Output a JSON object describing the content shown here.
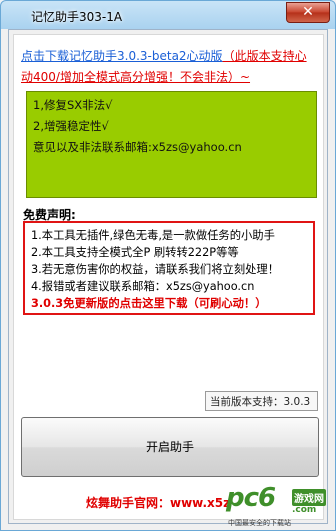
{
  "window": {
    "title": "记忆助手303-1A",
    "close_label": "✕",
    "app_icon": "apple-icon",
    "colors": {
      "frame": "#a9d2ef",
      "close": "#c7432c"
    }
  },
  "download_link": {
    "part1": "点击下载记忆助手3.0.3-beta2心动版",
    "part2": "（此版本支持心动400/增加全模式高分增强！不会非法）~"
  },
  "changelog": {
    "background": "#99cc00",
    "lines": [
      "1,修复SX非法√",
      "2,增强稳定性√",
      "意见以及非法联系邮箱:x5zs@yahoo.cn"
    ]
  },
  "disclaimer": {
    "title": "免费声明:",
    "items": [
      "1.本工具无插件,绿色无毒,是一款做任务的小助手",
      "2.本工具支持全模式全P 刷转转222P等等",
      "3.若无意伤害你的权益，请联系我们将立刻处理！",
      "4.报错或者建议联系邮箱：x5zs@yahoo.cn"
    ],
    "update_link": "3.0.3免更新版的点击这里下载（可刷心动！）"
  },
  "version": {
    "label": "当前版本支持：3.0.3"
  },
  "start_button": {
    "label": "开启助手"
  },
  "footer": {
    "text": "炫舞助手官网：www.x5z"
  },
  "watermark": {
    "pc": "pc6",
    "tag": "游戏网",
    "domain": ".com",
    "slogan": "中国最安全的下载站"
  }
}
